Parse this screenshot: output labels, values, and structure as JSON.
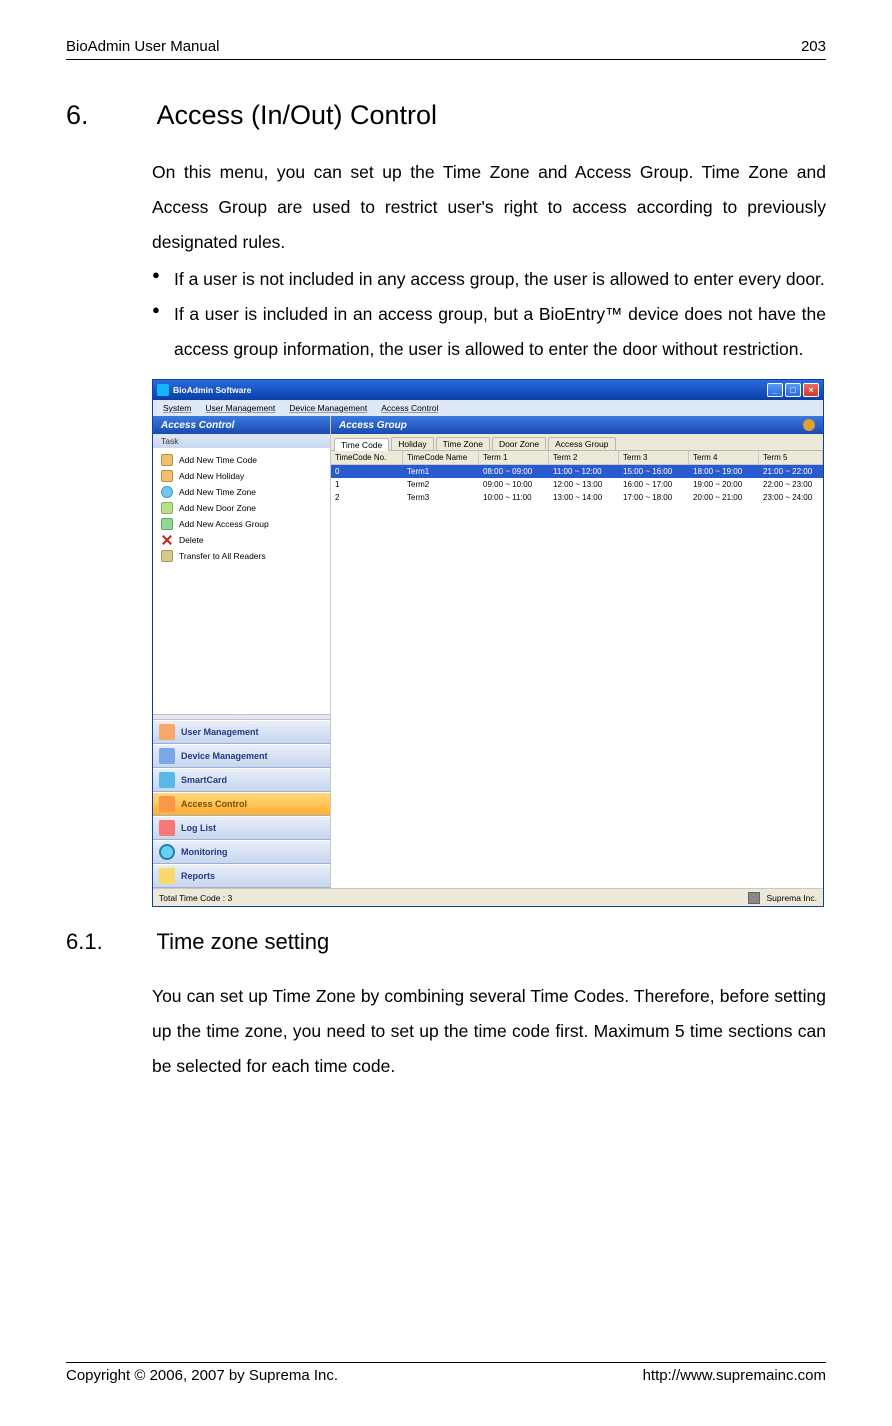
{
  "header": {
    "title": "BioAdmin User Manual",
    "page": "203"
  },
  "section6": {
    "number": "6.",
    "title": "Access (In/Out) Control",
    "intro": "On this menu, you can set up the Time Zone and Access Group. Time Zone and Access Group are used to restrict user's right to access according to previously designated rules.",
    "bullet1": "If a user is not included in any access group, the user is allowed to enter every door.",
    "bullet2": "If a user is included in an access group, but a BioEntry™ device does not have the access group information, the user is allowed to enter the door without restriction."
  },
  "app": {
    "title": "BioAdmin Software",
    "menus": [
      "System",
      "User Management",
      "Device Management",
      "Access Control"
    ],
    "sidebar": {
      "header": "Access Control",
      "task_label": "Task",
      "tasks": [
        "Add New Time Code",
        "Add New Holiday",
        "Add New Time Zone",
        "Add New Door Zone",
        "Add New Access Group",
        "Delete",
        "Transfer to All Readers"
      ],
      "nav": [
        "User Management",
        "Device Management",
        "SmartCard",
        "Access Control",
        "Log List",
        "Monitoring",
        "Reports"
      ]
    },
    "main": {
      "header": "Access Group",
      "tabs": [
        "Time Code",
        "Holiday",
        "Time Zone",
        "Door Zone",
        "Access Group"
      ],
      "columns": [
        "TimeCode No.",
        "TimeCode Name",
        "Term 1",
        "Term 2",
        "Term 3",
        "Term 4",
        "Term 5"
      ],
      "rows": [
        {
          "no": "0",
          "name": "Term1",
          "t1": "08:00 ~ 09:00",
          "t2": "11:00 ~ 12:00",
          "t3": "15:00 ~ 16:00",
          "t4": "18:00 ~ 19:00",
          "t5": "21:00 ~ 22:00"
        },
        {
          "no": "1",
          "name": "Term2",
          "t1": "09:00 ~ 10:00",
          "t2": "12:00 ~ 13:00",
          "t3": "16:00 ~ 17:00",
          "t4": "19:00 ~ 20:00",
          "t5": "22:00 ~ 23:00"
        },
        {
          "no": "2",
          "name": "Term3",
          "t1": "10:00 ~ 11:00",
          "t2": "13:00 ~ 14:00",
          "t3": "17:00 ~ 18:00",
          "t4": "20:00 ~ 21:00",
          "t5": "23:00 ~ 24:00"
        }
      ]
    },
    "status": {
      "left": "Total Time Code : 3",
      "right": "Suprema Inc."
    }
  },
  "section61": {
    "number": "6.1.",
    "title": "Time zone setting",
    "body": "You can set up Time Zone by combining several Time Codes. Therefore, before setting up the time zone, you need to set up the time code first.   Maximum 5 time sections can be selected for each time code."
  },
  "footer": {
    "copyright": "Copyright © 2006, 2007 by Suprema Inc.",
    "url": "http://www.supremainc.com"
  }
}
